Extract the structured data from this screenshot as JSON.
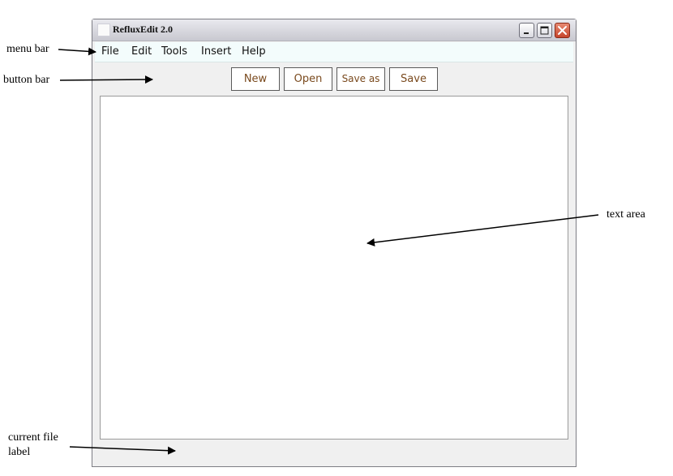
{
  "window": {
    "title": "RefluxEdit 2.0"
  },
  "menubar": {
    "items": [
      "File",
      "Edit",
      "Tools",
      "Insert",
      "Help"
    ]
  },
  "buttonbar": {
    "buttons": [
      "New",
      "Open",
      "Save as",
      "Save"
    ]
  },
  "textarea": {
    "content": ""
  },
  "statusbar": {
    "current_file": ""
  },
  "annotations": {
    "menu_bar": "menu bar",
    "button_bar": "button bar",
    "text_area": "text area",
    "current_file_label": "current file label"
  },
  "colors": {
    "menubar_bg": "#f3fcfc",
    "button_text": "#7a4a1e",
    "close_button": "#c6452b"
  }
}
